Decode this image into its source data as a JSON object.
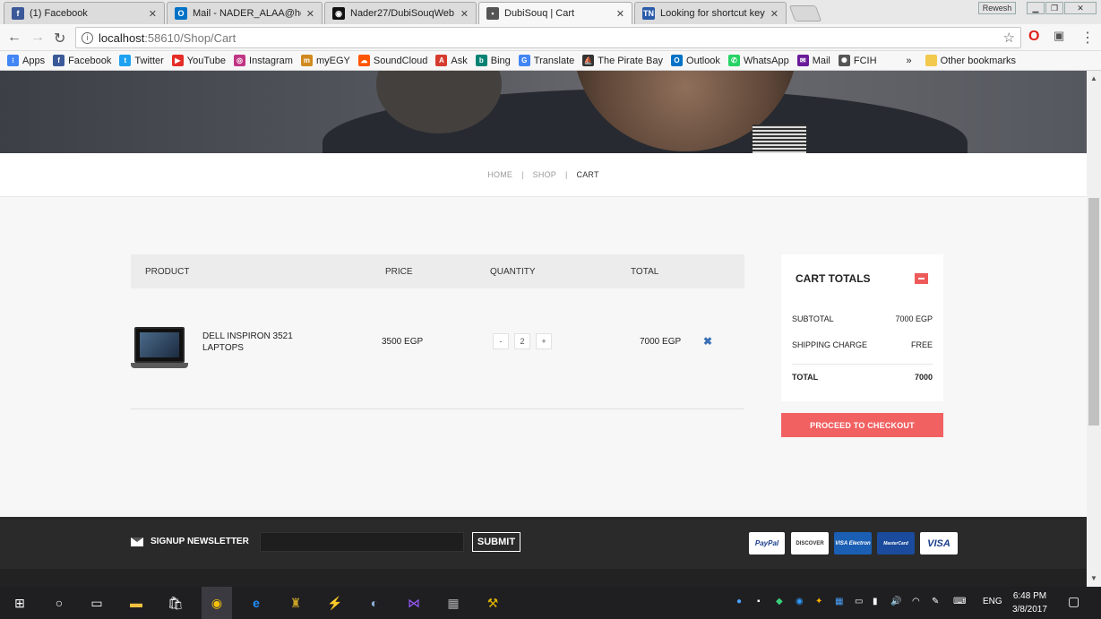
{
  "browser": {
    "tabs": [
      {
        "title": "(1) Facebook",
        "icon": "facebook-icon",
        "color": "#3b5998",
        "glyph": "f"
      },
      {
        "title": "Mail - NADER_ALAA@ho",
        "icon": "outlook-icon",
        "color": "#0072c6",
        "glyph": "O"
      },
      {
        "title": "Nader27/DubiSouqWeb",
        "icon": "github-icon",
        "color": "#111111",
        "glyph": "◉"
      },
      {
        "title": "DubiSouq | Cart",
        "icon": "page-icon",
        "color": "#555555",
        "glyph": "▪"
      },
      {
        "title": "Looking for shortcut key",
        "icon": "tn-icon",
        "color": "#2a5caa",
        "glyph": "TN"
      }
    ],
    "profile_button": "Rewesh",
    "url_host": "localhost",
    "url_path": ":58610/Shop/Cart",
    "bookmarks": [
      {
        "label": "Apps",
        "icon": "apps-icon",
        "color": "#4285f4",
        "glyph": "⋮"
      },
      {
        "label": "Facebook",
        "icon": "facebook-icon",
        "color": "#3b5998",
        "glyph": "f"
      },
      {
        "label": "Twitter",
        "icon": "twitter-icon",
        "color": "#1da1f2",
        "glyph": "t"
      },
      {
        "label": "YouTube",
        "icon": "youtube-icon",
        "color": "#e52d27",
        "glyph": "▶"
      },
      {
        "label": "Instagram",
        "icon": "instagram-icon",
        "color": "#c13584",
        "glyph": "◎"
      },
      {
        "label": "myEGY",
        "icon": "myegy-icon",
        "color": "#d18a1e",
        "glyph": "m"
      },
      {
        "label": "SoundCloud",
        "icon": "soundcloud-icon",
        "color": "#ff5500",
        "glyph": "☁"
      },
      {
        "label": "Ask",
        "icon": "ask-icon",
        "color": "#d63b2f",
        "glyph": "A"
      },
      {
        "label": "Bing",
        "icon": "bing-icon",
        "color": "#008373",
        "glyph": "b"
      },
      {
        "label": "Translate",
        "icon": "translate-icon",
        "color": "#4285f4",
        "glyph": "G"
      },
      {
        "label": "The Pirate Bay",
        "icon": "pirate-bay-icon",
        "color": "#333333",
        "glyph": "⛵"
      },
      {
        "label": "Outlook",
        "icon": "outlook-icon",
        "color": "#0072c6",
        "glyph": "O"
      },
      {
        "label": "WhatsApp",
        "icon": "whatsapp-icon",
        "color": "#25d366",
        "glyph": "✆"
      },
      {
        "label": "Mail",
        "icon": "mail-icon",
        "color": "#6a1b9a",
        "glyph": "✉"
      },
      {
        "label": "FCIH",
        "icon": "fcih-icon",
        "color": "#555555",
        "glyph": "✺"
      }
    ],
    "more_bookmarks": "»",
    "other_bookmarks": "Other bookmarks"
  },
  "breadcrumb": {
    "home": "HOME",
    "shop": "SHOP",
    "current": "CART",
    "separator": "|"
  },
  "cart": {
    "headers": {
      "product": "PRODUCT",
      "price": "PRICE",
      "quantity": "QUANTITY",
      "total": "TOTAL"
    },
    "items": [
      {
        "name": "DELL INSPIRON 3521 LAPTOPS",
        "price": "3500 EGP",
        "qty": "2",
        "total": "7000 EGP",
        "minus": "-",
        "plus": "+"
      }
    ]
  },
  "totals": {
    "title": "CART TOTALS",
    "subtotal_label": "SUBTOTAL",
    "subtotal_value": "7000 EGP",
    "shipping_label": "SHIPPING CHARGE",
    "shipping_value": "FREE",
    "total_label": "TOTAL",
    "total_value": "7000",
    "checkout": "PROCEED TO CHECKOUT"
  },
  "footer": {
    "newsletter_label": "SIGNUP NEWSLETTER",
    "email_value": "",
    "submit": "SUBMIT",
    "payments": [
      {
        "label": "PayPal",
        "icon": "paypal-icon",
        "bg": "#ffffff",
        "fg": "#1a3e8c"
      },
      {
        "label": "DISCOVER",
        "icon": "discover-icon",
        "bg": "#ffffff",
        "fg": "#333333"
      },
      {
        "label": "VISA Electron",
        "icon": "visa-electron-icon",
        "bg": "#1a5fb4",
        "fg": "#ffffff"
      },
      {
        "label": "MasterCard",
        "icon": "mastercard-icon",
        "bg": "#1a4b9c",
        "fg": "#ffffff"
      },
      {
        "label": "VISA",
        "icon": "visa-icon",
        "bg": "#ffffff",
        "fg": "#1a3e8c"
      }
    ]
  },
  "taskbar": {
    "language": "ENG",
    "time": "6:48 PM",
    "date": "3/8/2017"
  },
  "colors": {
    "accent": "#f16162",
    "remove": "#3a6fb5",
    "footer": "#2a2a2a"
  }
}
